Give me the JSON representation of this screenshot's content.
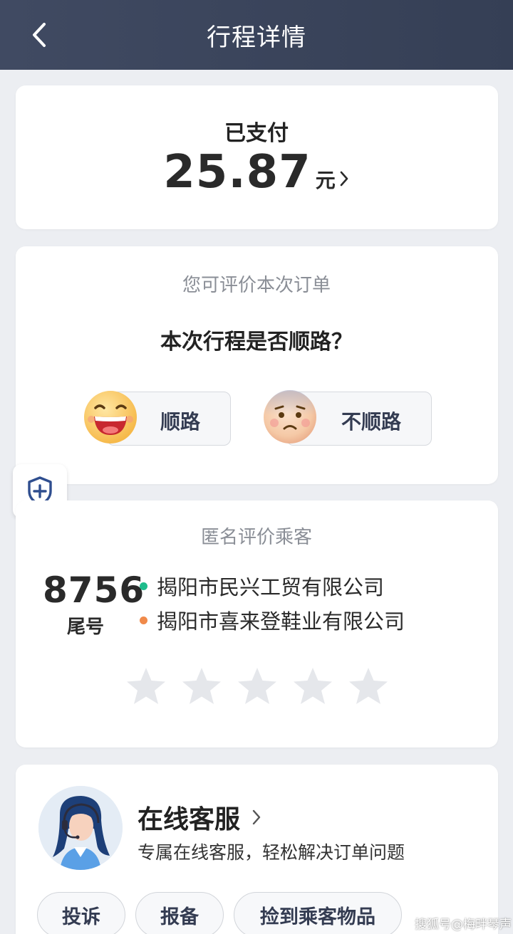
{
  "header": {
    "title": "行程详情",
    "back_icon": "chevron-left-icon"
  },
  "payment": {
    "status": "已支付",
    "amount": "25.87",
    "unit": "元"
  },
  "route_feedback": {
    "hint": "您可评价本次订单",
    "question": "本次行程是否顺路？",
    "options": [
      {
        "label": "顺路",
        "icon": "laughing-face-icon"
      },
      {
        "label": "不顺路",
        "icon": "worried-face-icon"
      }
    ]
  },
  "safety": {
    "icon": "shield-plus-icon"
  },
  "rating": {
    "title": "匿名评价乘客",
    "tail_number": "8756",
    "tail_label": "尾号",
    "from": "揭阳市民兴工贸有限公司",
    "to": "揭阳市喜来登鞋业有限公司",
    "star_count": 5,
    "rating_value": 0
  },
  "service": {
    "title": "在线客服",
    "desc": "专属在线客服，轻松解决订单问题",
    "buttons": [
      "投诉",
      "报备",
      "捡到乘客物品"
    ]
  },
  "watermark": "搜狐号@梅畔琴声",
  "colors": {
    "header_bg": "#3a445b",
    "page_bg": "#eceef2",
    "from_dot": "#1ebc8c",
    "to_dot": "#f08a4a",
    "accent": "#343c52",
    "star_empty": "#e5e7eb"
  }
}
